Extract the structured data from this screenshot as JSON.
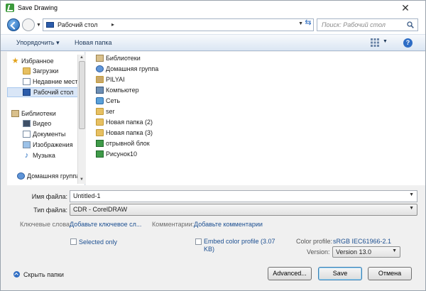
{
  "window": {
    "title": "Save Drawing"
  },
  "address": {
    "path": "Рабочий стол",
    "search_placeholder": "Поиск: Рабочий стол"
  },
  "toolbar": {
    "organize": "Упорядочить",
    "new_folder": "Новая папка"
  },
  "nav": {
    "favorites": "Избранное",
    "downloads": "Загрузки",
    "recent": "Недавние места",
    "desktop": "Рабочий стол",
    "libraries": "Библиотеки",
    "video": "Видео",
    "documents": "Документы",
    "images": "Изображения",
    "music": "Музыка",
    "homegroup": "Домашняя группа"
  },
  "files": [
    {
      "name": "Библиотеки",
      "icon": "library-icon"
    },
    {
      "name": "Домашняя группа",
      "icon": "homegroup-icon"
    },
    {
      "name": "PILYAI",
      "icon": "user-folder-icon"
    },
    {
      "name": "Компьютер",
      "icon": "computer-icon"
    },
    {
      "name": "Сеть",
      "icon": "network-icon"
    },
    {
      "name": "ser",
      "icon": "folder-icon"
    },
    {
      "name": "Новая папка (2)",
      "icon": "folder-icon"
    },
    {
      "name": "Новая папка (3)",
      "icon": "folder-icon"
    },
    {
      "name": "отрывной блок",
      "icon": "cdr-file-icon"
    },
    {
      "name": "Рисунок10",
      "icon": "cdr-file-icon"
    }
  ],
  "form": {
    "filename_label": "Имя файла:",
    "filename_value": "Untitled-1",
    "filetype_label": "Тип файла:",
    "filetype_value": "CDR - CorelDRAW",
    "keywords_label": "Ключевые слова:",
    "keywords_link": "Добавьте ключевое сл...",
    "comments_label": "Комментарии:",
    "comments_link": "Добавьте комментарии",
    "selected_only": "Selected only",
    "embed_profile_line1": "Embed color profile (3.07",
    "embed_profile_line2": "KB)",
    "color_profile_label": "Color profile:",
    "color_profile_value": "sRGB IEC61966-2.1",
    "version_label": "Version:",
    "version_value": "Version 13.0"
  },
  "buttons": {
    "hide_folders": "Скрыть папки",
    "advanced": "Advanced...",
    "save": "Save",
    "cancel": "Отмена"
  }
}
